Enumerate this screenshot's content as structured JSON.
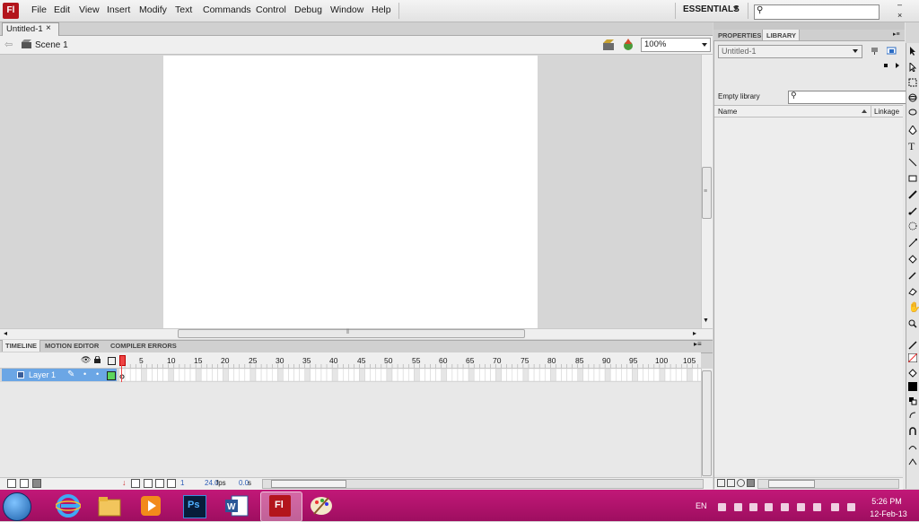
{
  "app": {
    "logo_text": "Fl"
  },
  "menu": [
    "File",
    "Edit",
    "View",
    "Insert",
    "Modify",
    "Text",
    "Commands",
    "Control",
    "Debug",
    "Window",
    "Help"
  ],
  "workspace": {
    "label": "ESSENTIALS",
    "search_placeholder": ""
  },
  "window_controls": {
    "minimize": "–",
    "close": "×"
  },
  "document": {
    "tab_label": "Untitled-1",
    "tab_close": "×",
    "scene_label": "Scene 1",
    "zoom": "100%"
  },
  "timeline": {
    "tabs": [
      "TIMELINE",
      "MOTION EDITOR",
      "COMPILER ERRORS"
    ],
    "frame_numbers": [
      "5",
      "10",
      "15",
      "20",
      "25",
      "30",
      "35",
      "40",
      "45",
      "50",
      "55",
      "60",
      "65",
      "70",
      "75",
      "80",
      "85",
      "90",
      "95",
      "100",
      "105"
    ],
    "layer_name": "Layer 1",
    "current_frame": "1",
    "fps": "24.0",
    "fps_unit": "fps",
    "elapsed": "0.0",
    "elapsed_unit": "s"
  },
  "library": {
    "tabs": [
      "PROPERTIES",
      "LIBRARY"
    ],
    "doc_select": "Untitled-1",
    "empty_label": "Empty library",
    "col_name": "Name",
    "col_linkage": "Linkage"
  },
  "taskbar": {
    "lang": "EN",
    "time": "5:26 PM",
    "date": "12-Feb-13",
    "ps_label": "Ps",
    "fl_label": "Fl"
  },
  "colors": {
    "accent_red": "#b3151c",
    "taskbar": "#b01470",
    "layer_selected": "#6ba6e5",
    "layer_color_swatch": "#5cd65c",
    "playhead": "#e44444"
  }
}
